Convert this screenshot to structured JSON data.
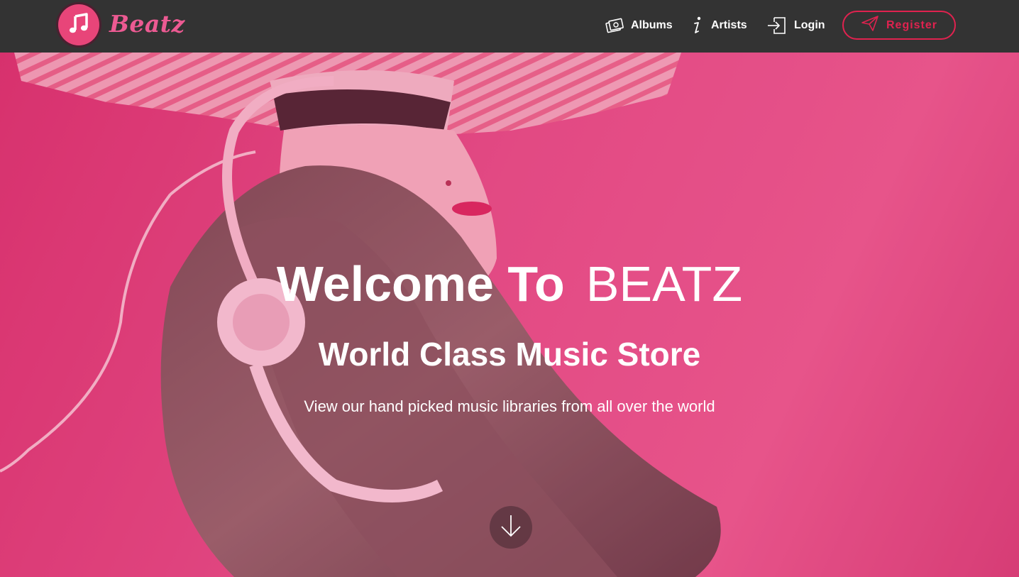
{
  "brand": {
    "name": "Beatz",
    "logo_icon": "music-note-icon",
    "accent_color": "#ec5a92",
    "logo_bg_color": "#e84579"
  },
  "nav": {
    "items": [
      {
        "label": "Albums",
        "icon": "albums-icon"
      },
      {
        "label": "Artists",
        "icon": "info-icon"
      },
      {
        "label": "Login",
        "icon": "login-icon"
      }
    ],
    "register": {
      "label": "Register",
      "icon": "paper-plane-icon",
      "color": "#e0224f"
    },
    "bar_color": "#333333"
  },
  "hero": {
    "title_bold": "Welcome To",
    "title_light": "BEATZ",
    "subtitle": "World Class Music Store",
    "tagline": "View our hand picked music libraries from all over the world",
    "scroll_icon": "arrow-down-icon",
    "background_color": "#e24d86"
  }
}
